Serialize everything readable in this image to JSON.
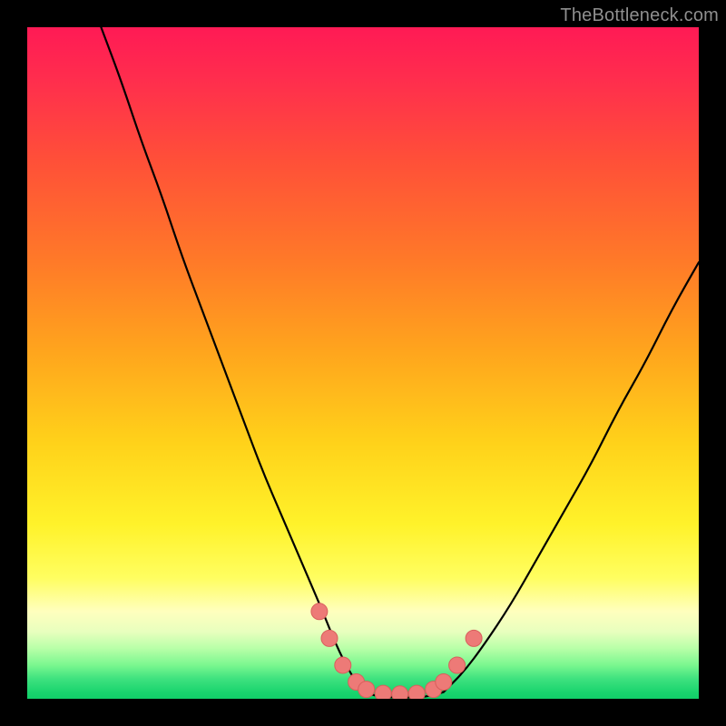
{
  "watermark": {
    "text": "TheBottleneck.com"
  },
  "colors": {
    "page_bg": "#000000",
    "curve_stroke": "#000000",
    "marker_fill": "#ed7a77",
    "marker_stroke": "#d85f5c",
    "watermark": "#8f8f8f"
  },
  "chart_data": {
    "type": "line",
    "title": "",
    "xlabel": "",
    "ylabel": "",
    "xlim": [
      0,
      100
    ],
    "ylim": [
      0,
      100
    ],
    "grid": false,
    "legend": false,
    "background": "rainbow-vertical-gradient",
    "series": [
      {
        "name": "bottleneck-curve-left",
        "x": [
          11,
          14,
          17,
          20,
          23,
          26,
          29,
          32,
          35,
          38,
          41,
          44,
          46,
          48,
          50
        ],
        "y": [
          100,
          92,
          83,
          75,
          66,
          58,
          50,
          42,
          34,
          27,
          20,
          13,
          8,
          4,
          1
        ]
      },
      {
        "name": "bottleneck-trough",
        "x": [
          50,
          52,
          54,
          56,
          58,
          60,
          62
        ],
        "y": [
          1,
          0.4,
          0.2,
          0.2,
          0.2,
          0.4,
          1
        ]
      },
      {
        "name": "bottleneck-curve-right",
        "x": [
          62,
          65,
          68,
          72,
          76,
          80,
          84,
          88,
          92,
          96,
          100
        ],
        "y": [
          1,
          4,
          8,
          14,
          21,
          28,
          35,
          43,
          50,
          58,
          65
        ]
      }
    ],
    "markers": {
      "name": "highlighted-points",
      "x": [
        43.5,
        45.0,
        47.0,
        49.0,
        50.5,
        53.0,
        55.5,
        58.0,
        60.5,
        62.0,
        64.0,
        66.5
      ],
      "y": [
        13.0,
        9.0,
        5.0,
        2.5,
        1.4,
        0.8,
        0.7,
        0.8,
        1.4,
        2.5,
        5.0,
        9.0
      ]
    }
  }
}
